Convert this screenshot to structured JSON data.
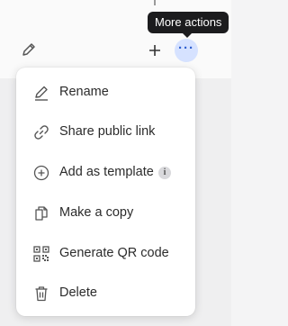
{
  "tooltip": {
    "text": "More actions"
  },
  "toolbar": {
    "plus_symbol": "+",
    "more_symbol": "···"
  },
  "menu": {
    "items": [
      {
        "label": "Rename",
        "icon": "pencil-icon"
      },
      {
        "label": "Share public link",
        "icon": "link-icon"
      },
      {
        "label": "Add as template",
        "icon": "add-circle-icon",
        "info_badge": "i"
      },
      {
        "label": "Make a copy",
        "icon": "copy-icon"
      },
      {
        "label": "Generate QR code",
        "icon": "qr-code-icon"
      },
      {
        "label": "Delete",
        "icon": "trash-icon"
      }
    ]
  },
  "colors": {
    "accent": "#2f5fd0",
    "accent_bg": "#d6e2ff",
    "tooltip_bg": "#1c1c1e",
    "text": "#2b2b2b",
    "icon": "#555555"
  }
}
